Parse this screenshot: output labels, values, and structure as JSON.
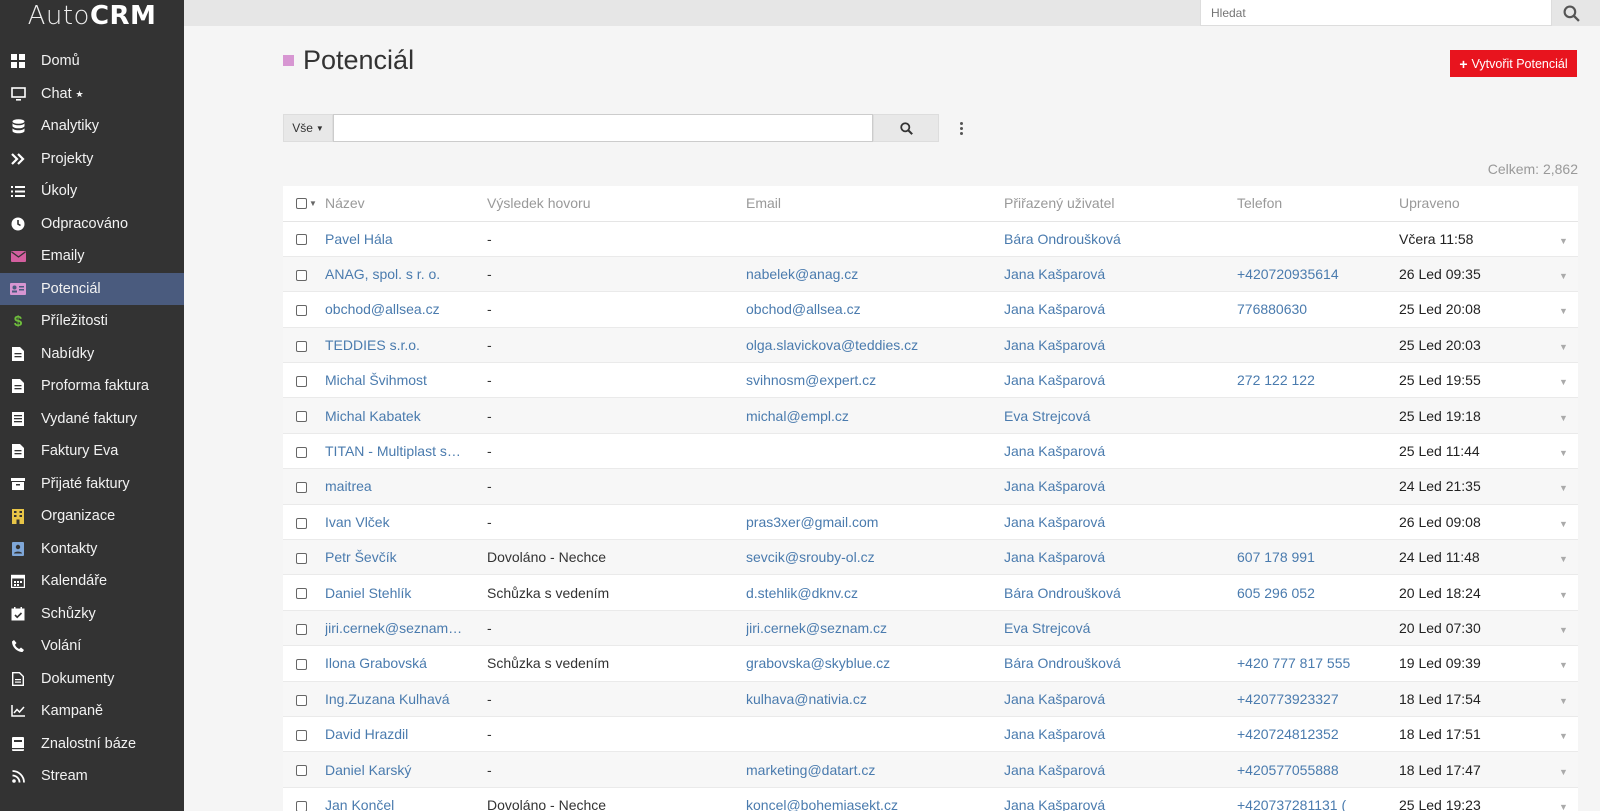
{
  "brand": {
    "thin": "Auto",
    "bold": "CRM"
  },
  "nav": [
    {
      "label": "Domů",
      "icon": "dashboard-icon"
    },
    {
      "label": "Chat ⭑",
      "icon": "monitor-icon"
    },
    {
      "label": "Analytiky",
      "icon": "database-icon"
    },
    {
      "label": "Projekty",
      "icon": "double-chevron-icon"
    },
    {
      "label": "Úkoly",
      "icon": "task-list-icon"
    },
    {
      "label": "Odpracováno",
      "icon": "clock-icon"
    },
    {
      "label": "Emaily",
      "icon": "envelope-icon"
    },
    {
      "label": "Potenciál",
      "icon": "id-card-icon",
      "active": true
    },
    {
      "label": "Příležitosti",
      "icon": "dollar-icon"
    },
    {
      "label": "Nabídky",
      "icon": "document-icon"
    },
    {
      "label": "Proforma faktura",
      "icon": "document-icon"
    },
    {
      "label": "Vydané faktury",
      "icon": "invoice-icon"
    },
    {
      "label": "Faktury Eva",
      "icon": "document-icon"
    },
    {
      "label": "Přijaté faktury",
      "icon": "inbox-icon"
    },
    {
      "label": "Organizace",
      "icon": "building-icon"
    },
    {
      "label": "Kontakty",
      "icon": "contact-icon"
    },
    {
      "label": "Kalendáře",
      "icon": "calendar-icon"
    },
    {
      "label": "Schůzky",
      "icon": "calendar-check-icon"
    },
    {
      "label": "Volání",
      "icon": "phone-icon"
    },
    {
      "label": "Dokumenty",
      "icon": "file-icon"
    },
    {
      "label": "Kampaně",
      "icon": "chart-line-icon"
    },
    {
      "label": "Znalostní báze",
      "icon": "book-icon"
    },
    {
      "label": "Stream",
      "icon": "rss-icon"
    }
  ],
  "search": {
    "placeholder": "Hledat"
  },
  "page": {
    "title": "Potenciál",
    "create_label": "Vytvořit Potenciál",
    "filter_label": "Vše",
    "total": "Celkem: 2,862"
  },
  "colors": {
    "sidebar": "#333333",
    "active": "#4a5b7e",
    "accent": "#e8141e",
    "link": "#4a7bae",
    "title_square": "#d796d2"
  },
  "table": {
    "headers": [
      "Název",
      "Výsledek hovoru",
      "Email",
      "Přiřazený uživatel",
      "Telefon",
      "Upraveno"
    ],
    "rows": [
      [
        "Pavel Hála",
        "-",
        "",
        "Bára Ondroušková",
        "",
        "Včera 11:58"
      ],
      [
        "ANAG, spol. s r. o.",
        "-",
        "nabelek@anag.cz",
        "Jana Kašparová",
        "+420720935614",
        "26 Led 09:35"
      ],
      [
        "obchod@allsea.cz",
        "-",
        "obchod@allsea.cz",
        "Jana Kašparová",
        "776880630",
        "25 Led 20:08"
      ],
      [
        "TEDDIES s.r.o.",
        "-",
        "olga.slavickova@teddies.cz",
        "Jana Kašparová",
        "",
        "25 Led 20:03"
      ],
      [
        "Michal Švihmost",
        "-",
        "svihnosm@expert.cz",
        "Jana Kašparová",
        "272 122 122",
        "25 Led 19:55"
      ],
      [
        "Michal Kabatek",
        "-",
        "michal@empl.cz",
        "Eva Strejcová",
        "",
        "25 Led 19:18"
      ],
      [
        "TITAN - Multiplast s…",
        "-",
        "",
        "Jana Kašparová",
        "",
        "25 Led 11:44"
      ],
      [
        "maitrea",
        "-",
        "",
        "Jana Kašparová",
        "",
        "24 Led 21:35"
      ],
      [
        "Ivan Vlček",
        "-",
        "pras3xer@gmail.com",
        "Jana Kašparová",
        "",
        "26 Led 09:08"
      ],
      [
        "Petr Ševčík",
        "Dovoláno - Nechce",
        "sevcik@srouby-ol.cz",
        "Jana Kašparová",
        "607 178 991",
        "24 Led 11:48"
      ],
      [
        "Daniel Stehlík",
        "Schůzka s vedením",
        "d.stehlik@dknv.cz",
        "Bára Ondroušková",
        "605 296 052",
        "20 Led 18:24"
      ],
      [
        "jiri.cernek@seznam…",
        "-",
        "jiri.cernek@seznam.cz",
        "Eva Strejcová",
        "",
        "20 Led 07:30"
      ],
      [
        "Ilona Grabovská",
        "Schůzka s vedením",
        "grabovska@skyblue.cz",
        "Bára Ondroušková",
        "+420 777 817 555",
        "19 Led 09:39"
      ],
      [
        "Ing.Zuzana Kulhavá",
        "-",
        "kulhava@nativia.cz",
        "Jana Kašparová",
        "+420773923327",
        "18 Led 17:54"
      ],
      [
        "David Hrazdil",
        "-",
        "",
        "Jana Kašparová",
        "+420724812352",
        "18 Led 17:51"
      ],
      [
        "Daniel Karský",
        "-",
        "marketing@datart.cz",
        "Jana Kašparová",
        "+420577055888",
        "18 Led 17:47"
      ],
      [
        "Jan Končel",
        "Dovoláno - Nechce",
        "koncel@bohemiasekt.cz",
        "Jana Kašparová",
        "+420737281131 (",
        "25 Led 19:23"
      ]
    ]
  }
}
